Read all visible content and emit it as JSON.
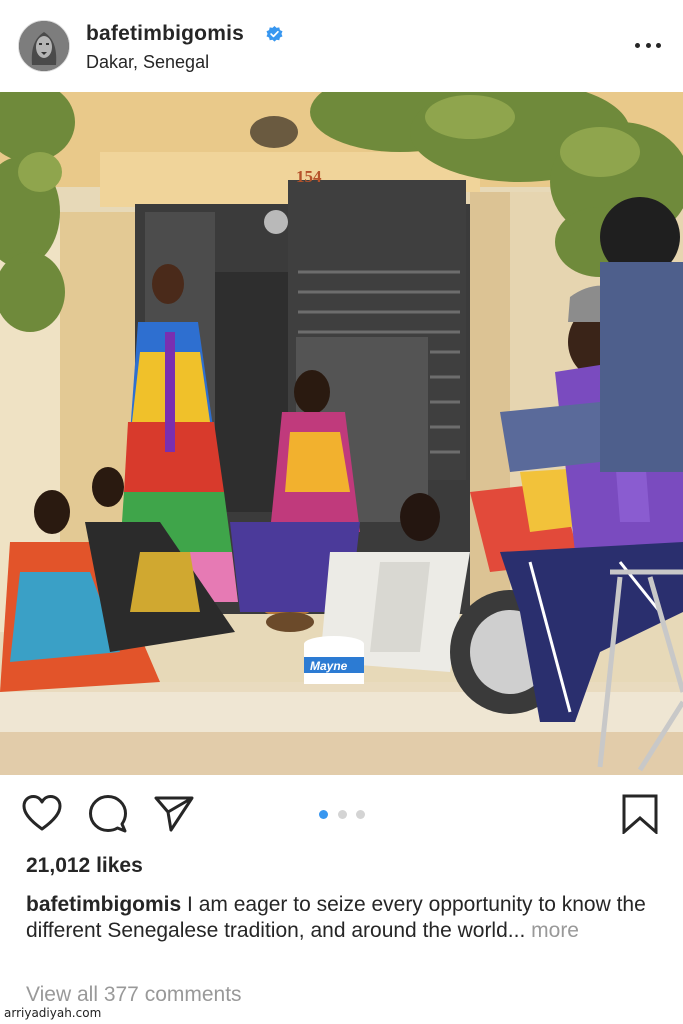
{
  "header": {
    "username": "bafetimbigomis",
    "location": "Dakar, Senegal",
    "verified": true,
    "avatar_icon": "lion-avatar-icon",
    "more_icon": "more-options-icon"
  },
  "photo": {
    "house_number": "154",
    "tub_label": "Mayne",
    "carousel_count": 3,
    "carousel_active": 1
  },
  "actions": {
    "like_icon": "heart-icon",
    "comment_icon": "comment-icon",
    "share_icon": "send-icon",
    "save_icon": "bookmark-icon"
  },
  "likes_text": "21,012 likes",
  "caption": {
    "username": "bafetimbigomis",
    "text": "I am eager to seize every opportunity to know the different Senegalese tradition, and around the world...",
    "more_label": "more"
  },
  "comments_link": "View all 377 comments",
  "watermark": "arriyadiyah.com",
  "colors": {
    "verified_blue": "#3897f0",
    "secondary_text": "#999999",
    "primary_text": "#262626"
  }
}
